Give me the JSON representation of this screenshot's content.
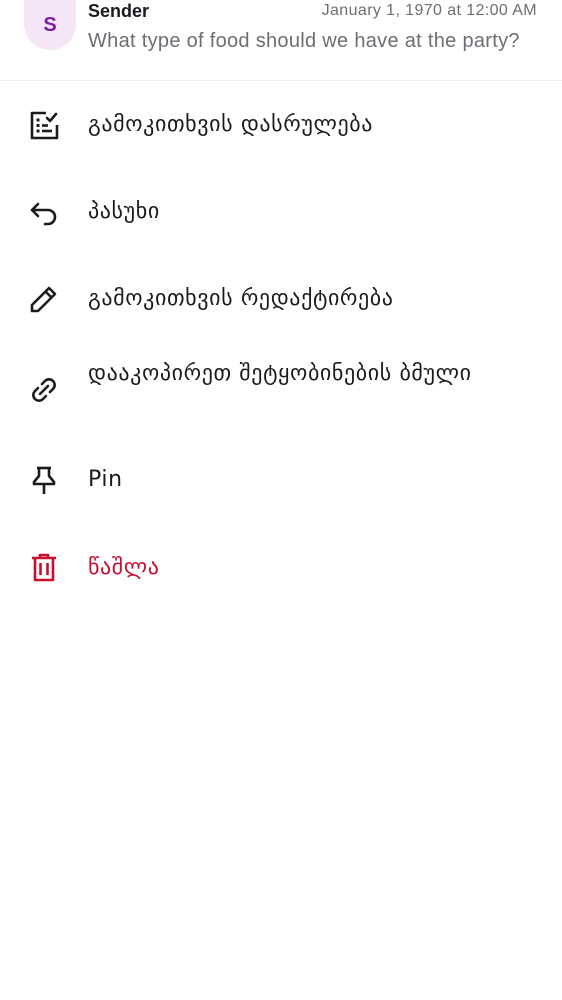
{
  "message": {
    "avatar_initial": "S",
    "sender": "Sender",
    "timestamp": "January 1, 1970 at 12:00 AM",
    "preview": "What type of food should we have at the party?"
  },
  "menu": {
    "items": [
      {
        "label": "გამოკითხვის დასრულება",
        "icon": "end-poll-icon"
      },
      {
        "label": "პასუხი",
        "icon": "reply-icon"
      },
      {
        "label": "გამოკითხვის რედაქტირება",
        "icon": "edit-icon"
      },
      {
        "label": "დააკოპირეთ შეტყობინების ბმული",
        "icon": "link-icon"
      },
      {
        "label": "Pin",
        "icon": "pin-icon"
      },
      {
        "label": "წაშლა",
        "icon": "delete-icon"
      }
    ]
  },
  "colors": {
    "danger": "#c8102e",
    "avatar_bg": "#f6e5f7",
    "avatar_text": "#7b1fa2"
  }
}
